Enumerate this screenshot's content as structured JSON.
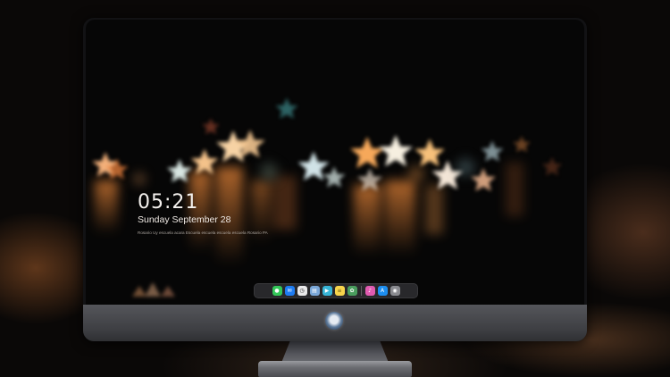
{
  "lock_screen": {
    "time": "05:21",
    "date": "Sunday September 28",
    "subtitle": "Rosario Uy escuela acara  Escuela escuela escuela escuela  Rosario PA"
  },
  "dock": {
    "apps": [
      {
        "name": "messages-icon",
        "color": "#34c759",
        "glyph": "💬"
      },
      {
        "name": "mail-icon",
        "color": "#1e7cf2",
        "glyph": "✉"
      },
      {
        "name": "clock-icon",
        "color": "#e9e9ea",
        "glyph": "◷"
      },
      {
        "name": "preview-icon",
        "color": "#7aa7d8",
        "glyph": "▤"
      },
      {
        "name": "clapper-icon",
        "color": "#37b4d6",
        "glyph": "▶"
      },
      {
        "name": "notes-icon",
        "color": "#f7d44c",
        "glyph": "≡"
      },
      {
        "name": "photos-icon",
        "color": "#4a9d5e",
        "glyph": "✿"
      },
      {
        "name": "itunes-icon",
        "color": "#e05bb0",
        "glyph": "♪"
      },
      {
        "name": "app-store-icon",
        "color": "#1d8ef0",
        "glyph": "A"
      },
      {
        "name": "camera-icon",
        "color": "#8a8b90",
        "glyph": "◉"
      }
    ]
  },
  "colors": {
    "bezel": "#121214",
    "chin": "#4a4b50",
    "bokeh_warm": "#f29a4c",
    "bokeh_cool": "#c8dcdc"
  }
}
